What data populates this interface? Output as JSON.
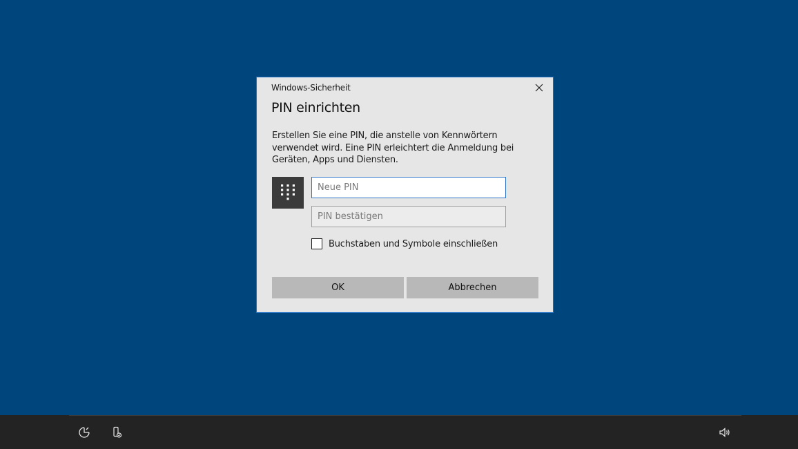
{
  "dialog": {
    "caption": "Windows-Sicherheit",
    "title": "PIN einrichten",
    "description": "Erstellen Sie eine PIN, die anstelle von Kennwörtern verwendet wird. Eine PIN erleichtert die Anmeldung bei Geräten, Apps und Diensten.",
    "new_pin": {
      "value": "",
      "placeholder": "Neue PIN"
    },
    "confirm_pin": {
      "value": "",
      "placeholder": "PIN bestätigen"
    },
    "include_letters": {
      "label": "Buchstaben und Symbole einschließen",
      "checked": false
    },
    "ok_label": "OK",
    "cancel_label": "Abbrechen",
    "icons": {
      "close": "close-icon",
      "keypad": "keypad-icon"
    },
    "colors": {
      "dialog_bg": "#e6e6e6",
      "accent_border": "#1e70c4",
      "button_bg": "#b8b8b8"
    }
  },
  "desktop": {
    "background": "#00457c"
  },
  "taskbar": {
    "icons": [
      "ease-of-access-icon",
      "narrator-icon",
      "volume-icon"
    ],
    "background": "#232323"
  }
}
